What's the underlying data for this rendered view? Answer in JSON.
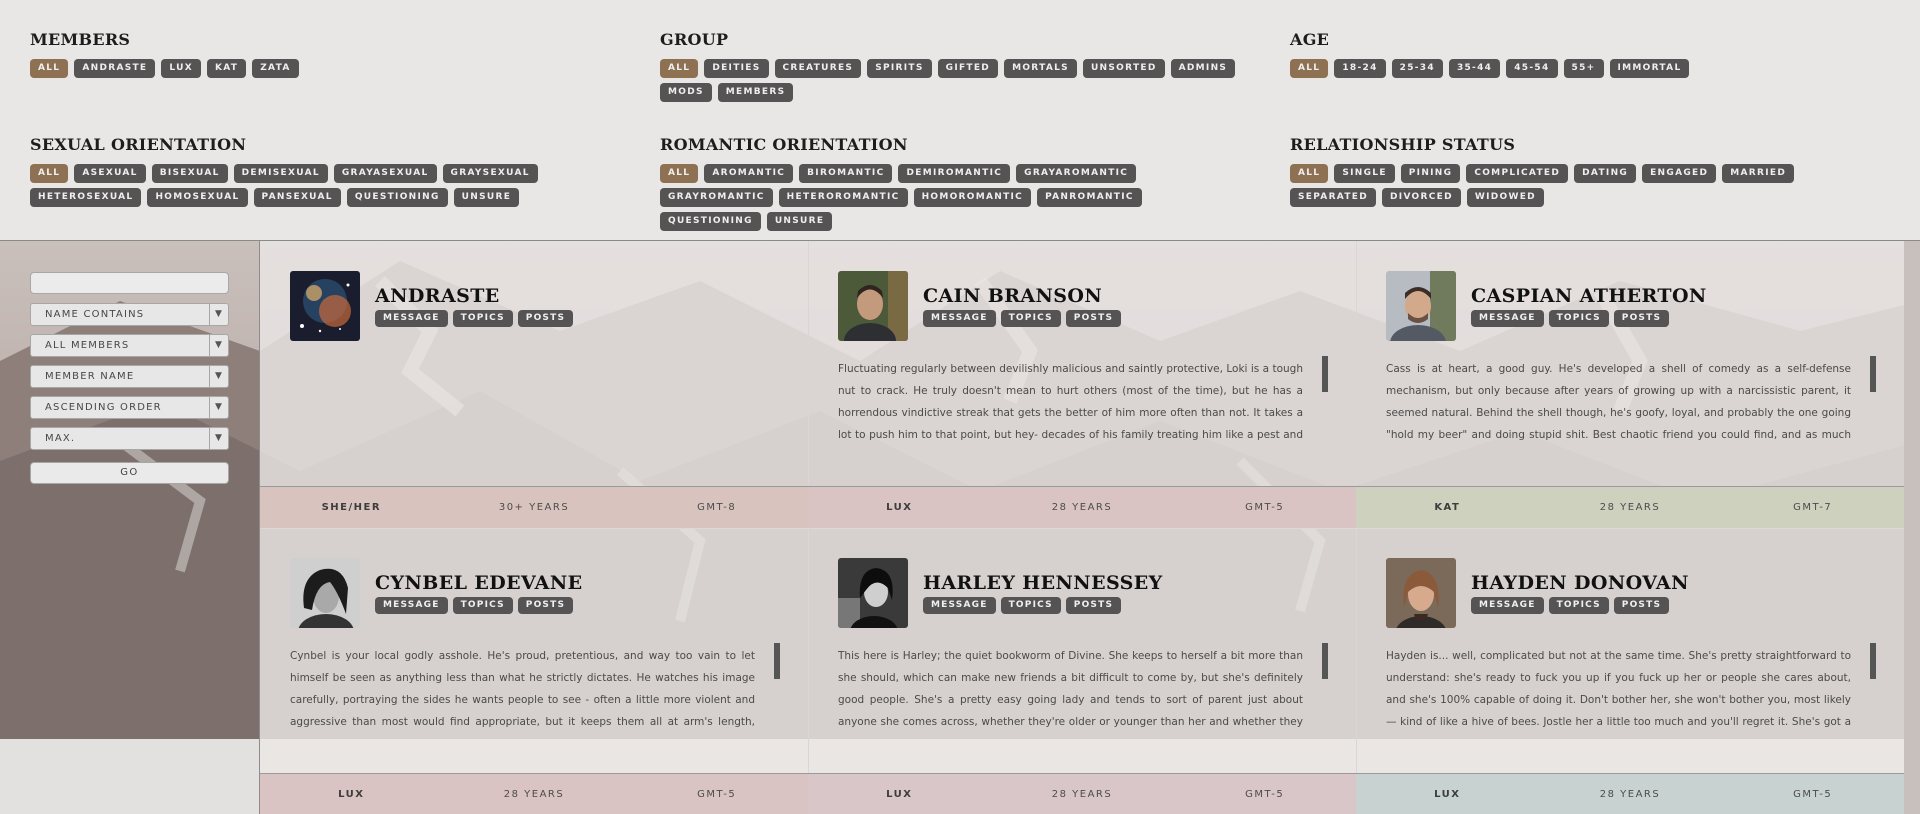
{
  "filters": {
    "members": {
      "title": "MEMBERS",
      "tags": [
        "ALL",
        "ANDRASTE",
        "LUX",
        "KAT",
        "ZATA"
      ]
    },
    "group": {
      "title": "GROUP",
      "tags": [
        "ALL",
        "DEITIES",
        "CREATURES",
        "SPIRITS",
        "GIFTED",
        "MORTALS",
        "UNSORTED",
        "ADMINS",
        "MODS",
        "MEMBERS"
      ]
    },
    "age": {
      "title": "AGE",
      "tags": [
        "ALL",
        "18-24",
        "25-34",
        "35-44",
        "45-54",
        "55+",
        "IMMORTAL"
      ]
    },
    "sexual": {
      "title": "SEXUAL ORIENTATION",
      "tags": [
        "ALL",
        "ASEXUAL",
        "BISEXUAL",
        "DEMISEXUAL",
        "GRAYASEXUAL",
        "GRAYSEXUAL",
        "HETEROSEXUAL",
        "HOMOSEXUAL",
        "PANSEXUAL",
        "QUESTIONING",
        "UNSURE"
      ]
    },
    "romantic": {
      "title": "ROMANTIC ORIENTATION",
      "tags": [
        "ALL",
        "AROMANTIC",
        "BIROMANTIC",
        "DEMIROMANTIC",
        "GRAYAROMANTIC",
        "GRAYROMANTIC",
        "HETEROROMANTIC",
        "HOMOROMANTIC",
        "PANROMANTIC",
        "QUESTIONING",
        "UNSURE"
      ]
    },
    "relationship": {
      "title": "RELATIONSHIP STATUS",
      "tags": [
        "ALL",
        "SINGLE",
        "PINING",
        "COMPLICATED",
        "DATING",
        "ENGAGED",
        "MARRIED",
        "SEPARATED",
        "DIVORCED",
        "WIDOWED"
      ]
    }
  },
  "sidebar": {
    "search_value": "",
    "selects": [
      "NAME CONTAINS",
      "ALL MEMBERS",
      "MEMBER NAME",
      "ASCENDING ORDER",
      "MAX."
    ],
    "go_label": "GO"
  },
  "buttons": {
    "message": "MESSAGE",
    "topics": "TOPICS",
    "posts": "POSTS"
  },
  "cards": [
    {
      "name": "ANDRASTE",
      "bio": "",
      "stats": [
        "SHE/HER",
        "30+ YEARS",
        "GMT-8"
      ],
      "stat_color": "#d9c3bf",
      "avatar": "nebula"
    },
    {
      "name": "CAIN BRANSON",
      "bio": "Fluctuating regularly between devilishly malicious and saintly protective, Loki is a tough nut to crack. He truly doesn't mean to hurt others (most of the time), but he has a horrendous vindictive streak that gets the better of him more often than not. It takes a lot to push him to that point, but hey- decades of his family treating him like a pest and an outsider was certainly more than enough. That said, newer relationships are easier, even though he has some pretty",
      "stats": [
        "LUX",
        "28 YEARS",
        "GMT-5"
      ],
      "stat_color": "#d9c3c3",
      "avatar": "man-forest"
    },
    {
      "name": "CASPIAN ATHERTON",
      "bio": "Cass is at heart, a good guy. He's developed a shell of comedy as a self-defense mechanism, but only because after years of growing up with a narcissistic parent, it seemed natural. Behind the shell though, he's goofy, loyal, and probably the one going \"hold my beer\" and doing stupid shit. Best chaotic friend you could find, and as much as others might hate to say it, a hell of a pilot",
      "stats": [
        "KAT",
        "28 YEARS",
        "GMT-7"
      ],
      "stat_color": "#cdd1be",
      "avatar": "man-smile"
    },
    {
      "name": "CYNBEL EDEVANE",
      "bio": "Cynbel is your local godly asshole. He's proud, pretentious, and way too vain to let himself be seen as anything less than what he strictly dictates. He watches his image carefully, portraying the sides he wants people to see - often a little more violent and aggressive than most would find appropriate, but it keeps them all at arm's length, which is part of the goal. God of non-violent death he may be, but that doesn't make him non-violent. He has mellowed a bit over the",
      "stats": [
        "LUX",
        "28 YEARS",
        "GMT-5"
      ],
      "stat_color": "#d9c3c3",
      "avatar": "man-bw"
    },
    {
      "name": "HARLEY HENNESSEY",
      "bio": "This here is Harley; the quiet bookworm of Divine. She keeps to herself a bit more than she should, which can make new friends a bit difficult to come by, but she's definitely good people. She's a pretty easy going lady and tends to sort of parent just about anyone she comes across, whether they're older or younger than her and whether they like it or not. She may not be pregnant, but she seems like she's practically in permanent nesting mode, so her apartment",
      "stats": [
        "LUX",
        "28 YEARS",
        "GMT-5"
      ],
      "stat_color": "#d8c6c9",
      "avatar": "woman-bw"
    },
    {
      "name": "HAYDEN DONOVAN",
      "bio": "Hayden is... well, complicated but not at the same time. She's pretty straightforward to understand: she's ready to fuck you up if you fuck up her or people she cares about, and she's 100% capable of doing it. Don't bother her, she won't bother you, most likely — kind of like a hive of bees. Jostle her a little too much and you'll regret it. She's got a lot of pent up rage and anger over her mistreatment at the hands of the government she served and trusted, and it was",
      "stats": [
        "LUX",
        "28 YEARS",
        "GMT-5"
      ],
      "stat_color": "#c8d2d1",
      "avatar": "woman-color"
    }
  ]
}
